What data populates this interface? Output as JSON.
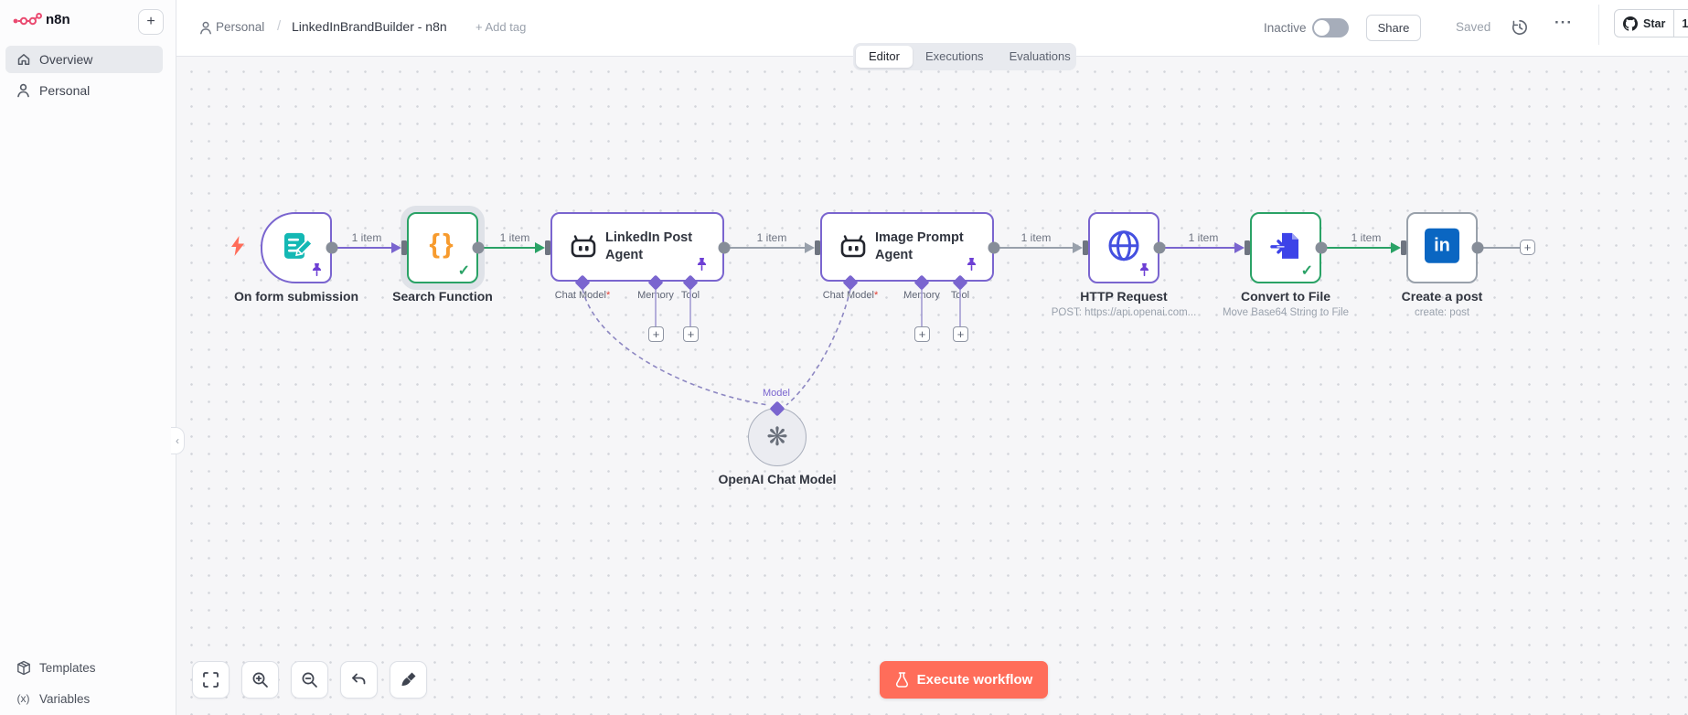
{
  "sidebar": {
    "logo_text": "n8n",
    "add_button_label": "+",
    "items": [
      {
        "label": "Overview",
        "icon": "home-icon",
        "active": true
      },
      {
        "label": "Personal",
        "icon": "person-icon",
        "active": false
      }
    ],
    "bottom_items": [
      {
        "label": "Templates",
        "icon": "package-icon"
      },
      {
        "label": "Variables",
        "icon": "variables-icon"
      }
    ],
    "collapse_label": "‹"
  },
  "header": {
    "breadcrumb": {
      "project": "Personal",
      "separator": "/",
      "workflow_title": "LinkedInBrandBuilder - n8n",
      "add_tag_label": "+ Add tag"
    },
    "tabs": [
      {
        "label": "Editor",
        "active": true
      },
      {
        "label": "Executions",
        "active": false
      },
      {
        "label": "Evaluations",
        "active": false
      }
    ],
    "activation_label": "Inactive",
    "activation_on": false,
    "share_label": "Share",
    "saved_label": "Saved",
    "more_label": "···",
    "github_star": {
      "label": "Star",
      "count": "1"
    }
  },
  "canvas": {
    "edge_label": "1 item",
    "nodes": [
      {
        "title": "On form submission",
        "icon": "form-icon",
        "pinned": true
      },
      {
        "title": "Search Function",
        "icon": "code-braces-icon",
        "success": true
      },
      {
        "title_line1": "LinkedIn Post",
        "title_line2": "Agent",
        "icon": "robot-icon",
        "pinned": true,
        "ports": [
          {
            "label": "Chat Model",
            "required": "*"
          },
          {
            "label": "Memory",
            "required": ""
          },
          {
            "label": "Tool",
            "required": ""
          }
        ]
      },
      {
        "title_line1": "Image Prompt",
        "title_line2": "Agent",
        "icon": "robot-icon",
        "pinned": true,
        "ports": [
          {
            "label": "Chat Model",
            "required": "*"
          },
          {
            "label": "Memory",
            "required": ""
          },
          {
            "label": "Tool",
            "required": ""
          }
        ]
      },
      {
        "title": "HTTP Request",
        "subtitle": "POST: https://api.openai.com...",
        "icon": "globe-icon",
        "pinned": true
      },
      {
        "title": "Convert to File",
        "subtitle": "Move Base64 String to File",
        "icon": "file-import-icon",
        "success": true
      },
      {
        "title": "Create a post",
        "subtitle": "create: post",
        "icon": "linkedin-icon"
      },
      {
        "title": "OpenAI Chat Model",
        "port_label": "Model",
        "icon": "openai-icon"
      }
    ],
    "plus_label": "+",
    "execute_button_label": "Execute workflow"
  },
  "colors": {
    "edge_purple": "#7a65cf",
    "edge_green": "#2aa266",
    "edge_gray": "#98a0ab",
    "execute_orange": "#ff6d5a",
    "linkedin_blue": "#0a66c2",
    "icon_teal": "#14b8b4",
    "icon_orange": "#f79b2e",
    "icon_indigo": "#4450e0",
    "icon_file_blue": "#3d43e8"
  }
}
